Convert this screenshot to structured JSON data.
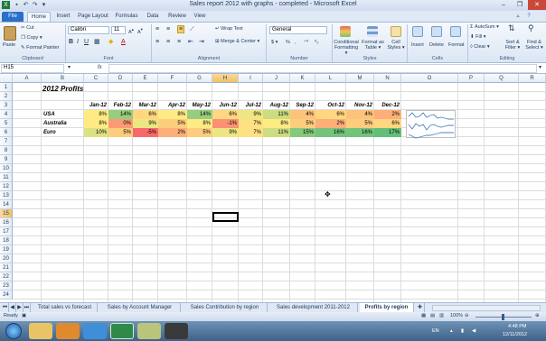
{
  "window": {
    "title": "Sales report 2012 with graphs - completed  -  Microsoft Excel",
    "minimize": "–",
    "restore": "❐",
    "close": "✕"
  },
  "ribbon_tabs": [
    "File",
    "Home",
    "Insert",
    "Page Layout",
    "Formulas",
    "Data",
    "Review",
    "View"
  ],
  "ribbon": {
    "clipboard": {
      "paste": "Paste",
      "cut": "Cut",
      "copy": "Copy ▾",
      "format_painter": "Format Painter",
      "label": "Clipboard"
    },
    "font": {
      "name": "Calibri",
      "size": "11",
      "label": "Font"
    },
    "alignment": {
      "wrap_text": "Wrap Text",
      "merge_center": "Merge & Center ▾",
      "label": "Alignment"
    },
    "number": {
      "format": "General",
      "currency": "$ ▾",
      "percent": "%",
      "comma": ",",
      "label": "Number"
    },
    "styles": {
      "conditional": "Conditional Formatting ▾",
      "format_table": "Format as Table ▾",
      "cell_styles": "Cell Styles ▾",
      "label": "Styles"
    },
    "cells": {
      "insert": "Insert",
      "delete": "Delete",
      "format": "Format",
      "label": "Cells"
    },
    "editing": {
      "autosum": "AutoSum ▾",
      "fill": "Fill ▾",
      "clear": "Clear ▾",
      "sort": "Sort & Filter ▾",
      "find": "Find & Select ▾",
      "label": "Editing"
    }
  },
  "formula_bar": {
    "name_box": "H15",
    "fx": "fx",
    "formula": ""
  },
  "columns": [
    "A",
    "B",
    "C",
    "D",
    "E",
    "F",
    "G",
    "H",
    "I",
    "J",
    "K",
    "L",
    "M",
    "N",
    "O",
    "P",
    "Q",
    "R"
  ],
  "rows": [
    "1",
    "2",
    "3",
    "4",
    "5",
    "6",
    "7",
    "8",
    "9",
    "10",
    "11",
    "12",
    "13",
    "14",
    "15",
    "16",
    "17",
    "18",
    "19",
    "20",
    "21",
    "22",
    "23",
    "24"
  ],
  "sheet": {
    "title": "2012 Profits",
    "months": [
      "Jan-12",
      "Feb-12",
      "Mar-12",
      "Apr-12",
      "May-12",
      "Jun-12",
      "Jul-12",
      "Aug-12",
      "Sep-12",
      "Oct-12",
      "Nov-12",
      "Dec-12"
    ],
    "regions": [
      {
        "name": "USA",
        "values": [
          "8%",
          "14%",
          "6%",
          "8%",
          "14%",
          "6%",
          "9%",
          "11%",
          "4%",
          "6%",
          "4%",
          "2%"
        ]
      },
      {
        "name": "Australia",
        "values": [
          "8%",
          "0%",
          "9%",
          "5%",
          "8%",
          "-1%",
          "7%",
          "8%",
          "5%",
          "2%",
          "5%",
          "6%"
        ]
      },
      {
        "name": "Euro",
        "values": [
          "10%",
          "5%",
          "-5%",
          "2%",
          "5%",
          "9%",
          "7%",
          "11%",
          "15%",
          "16%",
          "16%",
          "17%"
        ]
      }
    ]
  },
  "sheet_tabs": [
    "Total sales vs forecast",
    "Sales by Account Manager",
    "Sales Contribution by region",
    "Sales development 2011-2012",
    "Profits by region"
  ],
  "status": {
    "ready": "Ready",
    "zoom": "100%"
  },
  "taskbar": {
    "lang": "EN",
    "time": "4:48 PM",
    "date": "12/11/2012"
  }
}
